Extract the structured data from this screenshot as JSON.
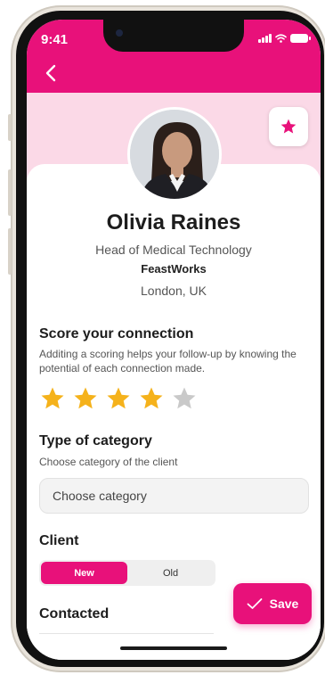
{
  "status_bar": {
    "time": "9:41"
  },
  "profile": {
    "name": "Olivia Raines",
    "role": "Head of Medical Technology",
    "company": "FeastWorks",
    "location": "London, UK"
  },
  "score": {
    "title": "Score your connection",
    "description": "Additing a scoring helps your follow-up by knowing the potential of each connection made.",
    "rating": 4,
    "max": 5
  },
  "category": {
    "title": "Type of category",
    "description": "Choose category of the client",
    "placeholder": "Choose category"
  },
  "client": {
    "title": "Client",
    "options": [
      "New",
      "Old"
    ],
    "selected": "New"
  },
  "contacted": {
    "title": "Contacted"
  },
  "save_button": {
    "label": "Save"
  },
  "colors": {
    "accent": "#e8117a",
    "accent_light": "#fbd9e7",
    "star_filled": "#f5b21b",
    "star_empty": "#c9c9c9"
  }
}
